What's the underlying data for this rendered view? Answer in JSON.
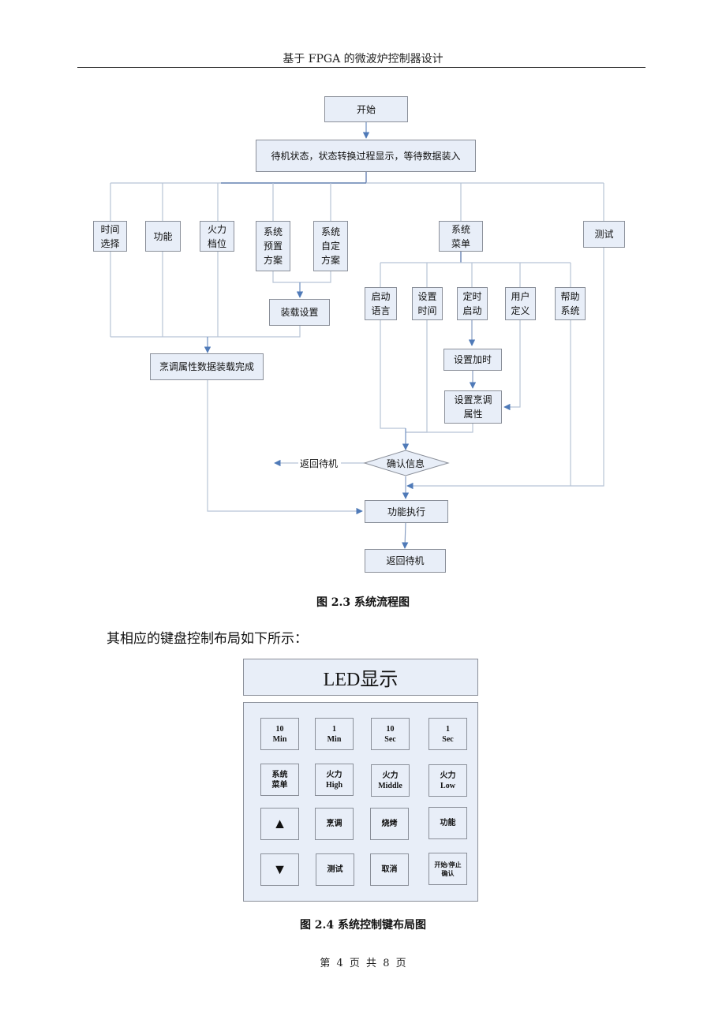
{
  "header": {
    "title": "基于 FPGA 的微波炉控制器设计"
  },
  "flowchart": {
    "colors": {
      "node_fill": "#e8eef8",
      "node_border": "#8a8f99",
      "line": "#b8c4d6",
      "arrow": "#4f7ab8"
    },
    "nodes": {
      "start": "开始",
      "standby": "待机状态，状态转换过程显示，等待数据装入",
      "time_select": "时间\n选择",
      "function": "功能",
      "power_level": "火力\n档位",
      "preset_plan": "系统\n预置\n方案",
      "custom_plan": "系统\n自定\n方案",
      "system_menu": "系统\n菜单",
      "test": "测试",
      "load_settings": "装载设置",
      "start_language": "启动\n语言",
      "set_time": "设置\n时间",
      "timed_start": "定时\n启动",
      "user_defined": "用户\n定义",
      "help_system": "帮助\n系统",
      "set_add_time": "设置加时",
      "set_cook_attr": "设置烹调\n属性",
      "cook_data_loaded": "烹调属性数据装载完成",
      "confirm_info": "确认信息",
      "execute_function": "功能执行",
      "return_standby": "返回待机"
    },
    "edge_labels": {
      "return_standby": "返回待机"
    },
    "caption": "图 2.3  系统流程图"
  },
  "paragraph": "其相应的键盘控制布局如下所示：",
  "keypad": {
    "display_label": "LED显示",
    "keys": [
      [
        "10\nMin",
        "1\nMin",
        "10\nSec",
        "1\nSec"
      ],
      [
        "系统\n菜单",
        "火力\nHigh",
        "火力\nMiddle",
        "火力\nLow"
      ],
      [
        "▲",
        "烹调",
        "烧烤",
        "功能"
      ],
      [
        "▼",
        "测试",
        "取消",
        "开始/停止\n确认"
      ]
    ],
    "caption": "图 2.4  系统控制键布局图"
  },
  "footer": {
    "page_text": "第 4 页 共 8 页",
    "current_page": 4,
    "total_pages": 8
  }
}
